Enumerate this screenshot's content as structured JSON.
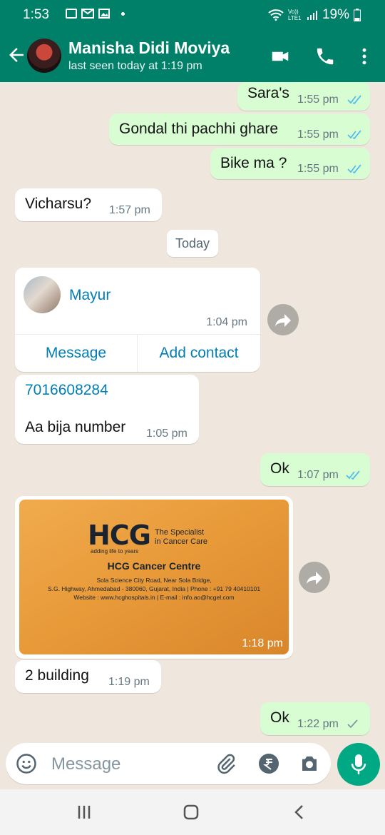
{
  "status_bar": {
    "time": "1:53",
    "battery": "19%",
    "signal_label": "Vo)) LTE1"
  },
  "header": {
    "name": "Manisha Didi Moviya",
    "last_seen": "last seen today at 1:19 pm"
  },
  "messages": [
    {
      "dir": "out",
      "text": "Sara's",
      "time": "1:55 pm",
      "ticks": "read"
    },
    {
      "dir": "out",
      "text": "Gondal thi pachhi ghare",
      "time": "1:55 pm",
      "ticks": "read"
    },
    {
      "dir": "out",
      "text": "Bike ma ?",
      "time": "1:55 pm",
      "ticks": "read"
    },
    {
      "dir": "in",
      "text": "Vicharsu?",
      "time": "1:57 pm"
    },
    {
      "dir": "in",
      "text": "7016608284",
      "text2": "Aa bija number",
      "time": "1:05 pm"
    },
    {
      "dir": "out",
      "text": "Ok",
      "time": "1:07 pm",
      "ticks": "read"
    },
    {
      "dir": "in",
      "text": "2 building",
      "time": "1:19 pm"
    },
    {
      "dir": "out",
      "text": "Ok",
      "time": "1:22 pm",
      "ticks": "sent"
    }
  ],
  "date_divider": "Today",
  "contact_card": {
    "name": "Mayur",
    "time": "1:04 pm",
    "message_btn": "Message",
    "add_contact_btn": "Add contact"
  },
  "image_message": {
    "time": "1:18 pm",
    "logo": "HCG",
    "logo_tag": "adding life to years",
    "slogan": "The Specialist\nin Cancer Care",
    "title": "HCG Cancer Centre",
    "line1": "Sola Science City Road, Near Sola Bridge,",
    "line2": "S.G. Highway, Ahmedabad - 380060, Gujarat, India | Phone : +91 79 40410101",
    "line3": "Website : www.hcghospitals.in  |  E-mail : info.ao@hcgel.com"
  },
  "input": {
    "placeholder": "Message"
  },
  "colors": {
    "header": "#008069",
    "outgoing": "#d9fdd3",
    "incoming": "#ffffff",
    "link": "#027eb5",
    "read_ticks": "#53bdeb",
    "mic": "#00a884"
  },
  "icons": [
    "back-arrow-icon",
    "video-call-icon",
    "phone-icon",
    "more-vert-icon",
    "emoji-icon",
    "attach-icon",
    "rupee-icon",
    "camera-icon",
    "mic-icon",
    "forward-icon"
  ]
}
